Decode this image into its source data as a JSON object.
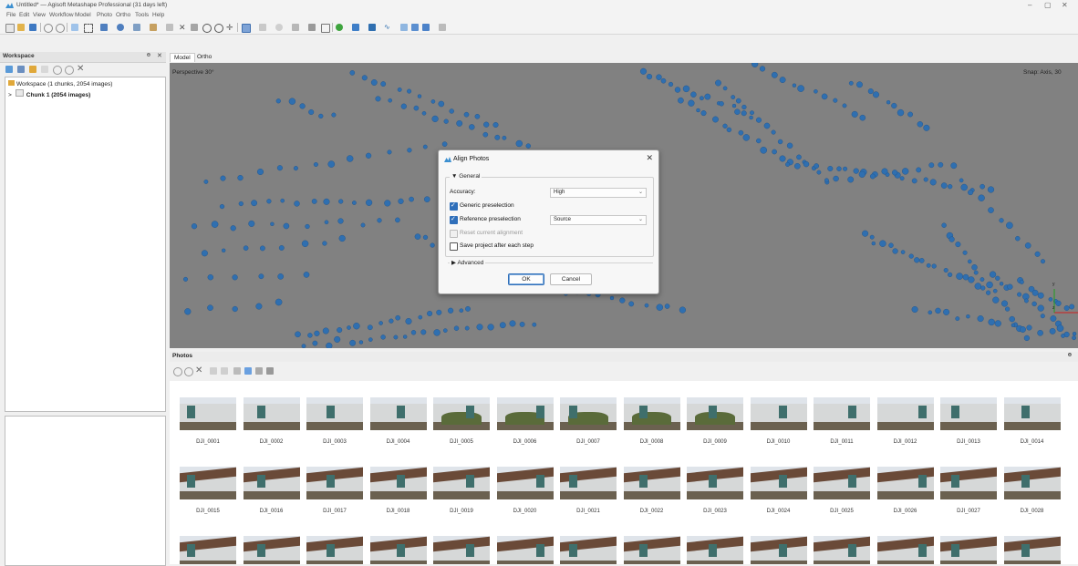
{
  "window": {
    "title": "Untitled* — Agisoft Metashape Professional (31 days left)"
  },
  "menu": [
    "File",
    "Edit",
    "View",
    "Workflow",
    "Model",
    "Photo",
    "Ortho",
    "Tools",
    "Help"
  ],
  "workspace": {
    "title": "Workspace",
    "root": "Workspace (1 chunks, 2054 images)",
    "chunk": "Chunk 1 (2054 images)"
  },
  "tabs": [
    "Model",
    "Ortho"
  ],
  "viewport": {
    "perspective": "Perspective 30°",
    "snap": "Snap: Axis, 30",
    "axis_y": "y",
    "axis_z": "z"
  },
  "dialog": {
    "title": "Align Photos",
    "general": "General",
    "accuracy_label": "Accuracy:",
    "accuracy_value": "High",
    "generic_preselection": "Generic preselection",
    "reference_preselection": "Reference preselection",
    "reference_value": "Source",
    "reset_alignment": "Reset current alignment",
    "save_project": "Save project after each step",
    "advanced": "Advanced",
    "ok": "OK",
    "cancel": "Cancel",
    "options": {
      "generic_preselection": true,
      "reference_preselection": true,
      "reset_alignment": false,
      "save_project": false
    }
  },
  "photos": {
    "title": "Photos",
    "items": [
      "DJI_0001",
      "DJI_0002",
      "DJI_0003",
      "DJI_0004",
      "DJI_0005",
      "DJI_0006",
      "DJI_0007",
      "DJI_0008",
      "DJI_0009",
      "DJI_0010",
      "DJI_0011",
      "DJI_0012",
      "DJI_0013",
      "DJI_0014",
      "DJI_0015",
      "DJI_0016",
      "DJI_0017",
      "DJI_0018",
      "DJI_0019",
      "DJI_0020",
      "DJI_0021",
      "DJI_0022",
      "DJI_0023",
      "DJI_0024",
      "DJI_0025",
      "DJI_0026",
      "DJI_0027",
      "DJI_0028"
    ]
  },
  "colors": {
    "points": "#2f6fb0",
    "viewport_bg": "#818181",
    "accent": "#2f6fba"
  }
}
